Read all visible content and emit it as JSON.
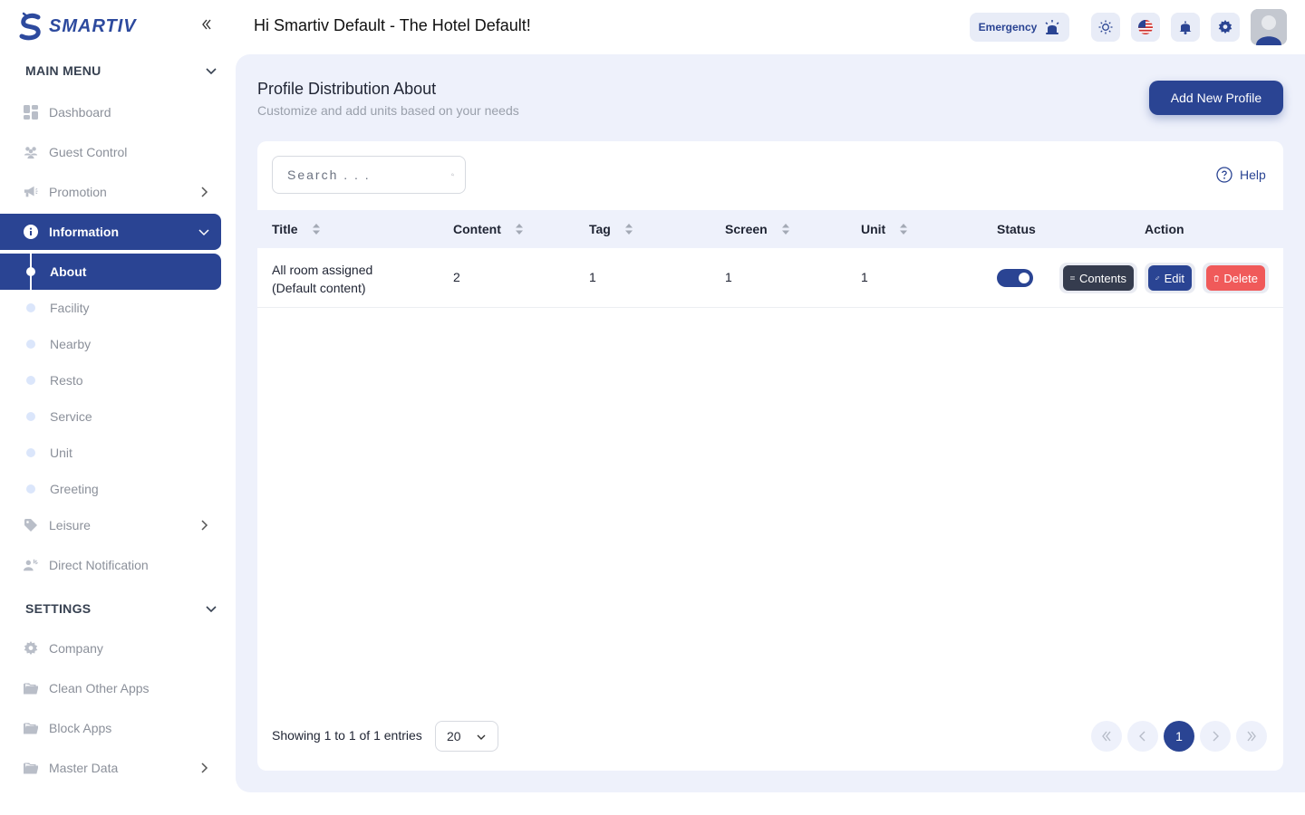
{
  "brand": {
    "name": "SMARTIV"
  },
  "header": {
    "greeting": "Hi Smartiv Default - The Hotel Default!",
    "emergency_label": "Emergency"
  },
  "sidebar": {
    "main_menu_title": "MAIN MENU",
    "items": [
      {
        "label": "Dashboard"
      },
      {
        "label": "Guest Control"
      },
      {
        "label": "Promotion"
      },
      {
        "label": "Information"
      },
      {
        "label": "Leisure"
      },
      {
        "label": "Direct Notification"
      }
    ],
    "information_sub": [
      {
        "label": "About"
      },
      {
        "label": "Facility"
      },
      {
        "label": "Nearby"
      },
      {
        "label": "Resto"
      },
      {
        "label": "Service"
      },
      {
        "label": "Unit"
      },
      {
        "label": "Greeting"
      }
    ],
    "settings_title": "SETTINGS",
    "settings_items": [
      {
        "label": "Company"
      },
      {
        "label": "Clean Other Apps"
      },
      {
        "label": "Block Apps"
      },
      {
        "label": "Master Data"
      }
    ]
  },
  "page": {
    "title": "Profile Distribution About",
    "subtitle": "Customize and add units based on your needs",
    "add_button": "Add New Profile",
    "search_placeholder": "Search . . .",
    "help_label": "Help"
  },
  "table": {
    "columns": [
      "Title",
      "Content",
      "Tag",
      "Screen",
      "Unit",
      "Status",
      "Action"
    ],
    "rows": [
      {
        "title_line1": "All room assigned",
        "title_line2": "(Default content)",
        "content": "2",
        "tag": "1",
        "screen": "1",
        "unit": "1",
        "status_on": true
      }
    ],
    "actions": {
      "contents": "Contents",
      "edit": "Edit",
      "delete": "Delete"
    }
  },
  "pagination": {
    "showing": "Showing 1 to 1 of 1 entries",
    "per_page": "20",
    "current_page": "1"
  },
  "colors": {
    "primary": "#2a4493",
    "danger": "#f05a5a",
    "dark": "#353c4e",
    "main_bg": "#eef1fb"
  }
}
